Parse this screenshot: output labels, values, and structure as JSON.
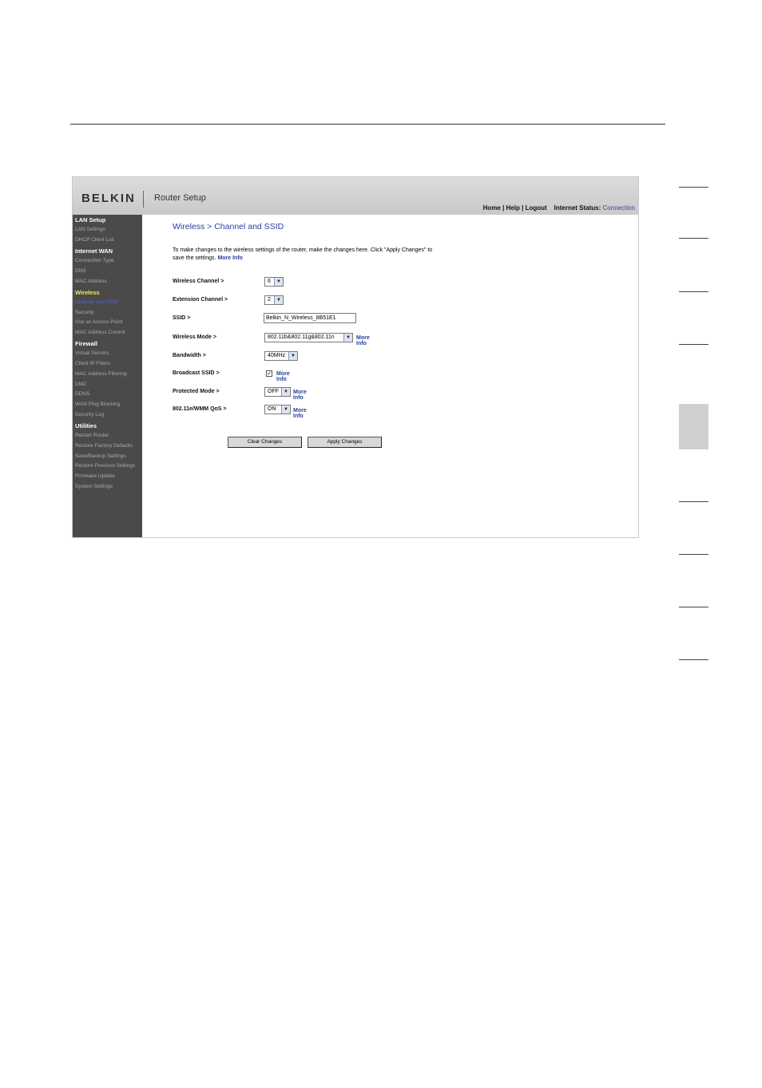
{
  "header": {
    "logo": "BELKIN",
    "app_title": "Router Setup",
    "links": {
      "home": "Home",
      "help": "Help",
      "logout": "Logout",
      "sep": "|"
    },
    "status_label": "Internet Status:",
    "status_value": "Connection"
  },
  "sidebar": {
    "lan_setup": "LAN Setup",
    "lan_settings": "LAN Settings",
    "dhcp_client_list": "DHCP Client List",
    "internet_wan": "Internet WAN",
    "connection_type": "Connection Type",
    "dns": "DNS",
    "mac_address": "MAC Address",
    "wireless": "Wireless",
    "channel_and_ssid": "Channel and SSID",
    "security": "Security",
    "use_as_access_point": "Use as Access Point",
    "mac_address_control": "MAC Address Control",
    "firewall": "Firewall",
    "virtual_servers": "Virtual Servers",
    "client_ip_filters": "Client IP Filters",
    "mac_address_filtering": "MAC Address Filtering",
    "dmz": "DMZ",
    "ddns": "DDNS",
    "wan_ping_blocking": "WAN Ping Blocking",
    "security_log": "Security Log",
    "utilities": "Utilities",
    "restart_router": "Restart Router",
    "restore_factory_defaults": "Restore Factory Defaults",
    "save_backup_settings": "Save/Backup Settings",
    "restore_previous_settings": "Restore Previous Settings",
    "firmware_update": "Firmware Update",
    "system_settings": "System Settings"
  },
  "main": {
    "title": "Wireless > Channel and SSID",
    "intro": "To make changes to the wireless settings of the router, make the changes here. Click \"Apply Changes\" to save the settings.",
    "more_info": "More Info",
    "fields": {
      "wireless_channel": {
        "label": "Wireless Channel >",
        "value": "6"
      },
      "extension_channel": {
        "label": "Extension Channel >",
        "value": "2"
      },
      "ssid": {
        "label": "SSID >",
        "value": "Belkin_N_Wireless_8B51E1"
      },
      "wireless_mode": {
        "label": "Wireless Mode >",
        "value": "802.11b&802.11g&802.11n"
      },
      "bandwidth": {
        "label": "Bandwidth >",
        "value": "40MHz"
      },
      "broadcast_ssid": {
        "label": "Broadcast SSID >",
        "checked": true,
        "check_glyph": "✓"
      },
      "protected_mode": {
        "label": "Protected Mode >",
        "value": "OFF"
      },
      "wmm_qos": {
        "label": "802.11e/WMM QoS >",
        "value": "ON"
      }
    },
    "clear_button": "Clear Changes",
    "apply_button": "Apply Changes",
    "dropdown_arrow": "▼"
  },
  "colors": {
    "link": "#2a3fa0",
    "sidebar_bg": "#4a4a4a",
    "active_section": "#f0e85a",
    "current_item": "#5566cc"
  }
}
